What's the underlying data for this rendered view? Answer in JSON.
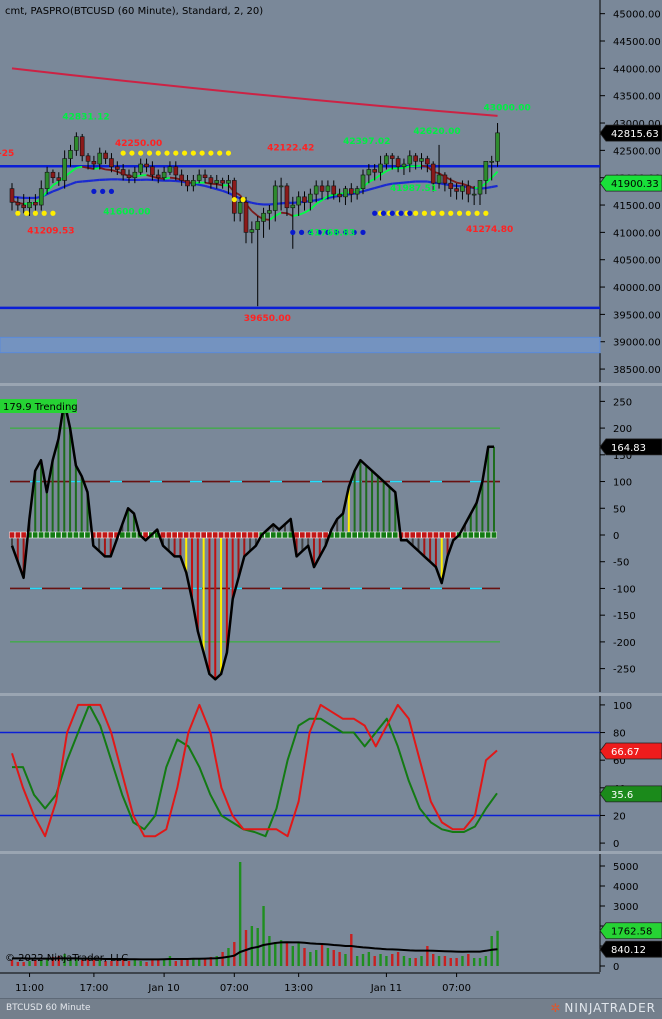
{
  "header": {
    "title": "cmt,  PASPRO(BTCUSD (60 Minute), Standard, 2, 20)",
    "copyright": "© 2022 NinjaTrader, LLC"
  },
  "status_bar": {
    "instrument": "BTCUSD 60 Minute",
    "brand": "NINJATRADER"
  },
  "colors": {
    "background": "#7a8899",
    "up_candle": "#2e8b2e",
    "down_candle": "#8b1a1a",
    "fast_ma": "#00ff44",
    "slow_ma": "#1a2ad0",
    "trend_line": "#cc2244",
    "support_line": "#0a1ed6",
    "cci_line": "#000000",
    "stoch_k": "#e01818",
    "stoch_d": "#137a13"
  },
  "chart_data": [
    {
      "type": "candlestick",
      "panel": "price",
      "price_axis_labels": [
        "45000.00",
        "44500.00",
        "44000.00",
        "43500.00",
        "43000.00",
        "42500.00",
        "42000.00",
        "41500.00",
        "41000.00",
        "40500.00",
        "40000.00",
        "39500.00",
        "39000.00",
        "38500.00"
      ],
      "price_tick_values": [
        45000,
        44500,
        44000,
        43500,
        43000,
        42500,
        42000,
        41500,
        41000,
        40500,
        40000,
        39500,
        39000,
        38500
      ],
      "ylim": [
        38300,
        45250
      ],
      "time_labels": [
        "11:00",
        "17:00",
        "Jan 10",
        "07:00",
        "13:00",
        "Jan 11",
        "07:00"
      ],
      "time_label_index": [
        3,
        14,
        26,
        38,
        49,
        64,
        76
      ],
      "bar_count": 84,
      "opens": [
        41800,
        41550,
        41500,
        41450,
        41550,
        41500,
        41800,
        42100,
        42000,
        41950,
        42350,
        42500,
        42750,
        42400,
        42300,
        42250,
        42450,
        42350,
        42200,
        42150,
        42050,
        42000,
        42100,
        42250,
        42200,
        42050,
        42000,
        42100,
        42200,
        42050,
        41950,
        41850,
        41950,
        42050,
        42000,
        41900,
        41950,
        41900,
        41950,
        41350,
        41550,
        41000,
        41050,
        41200,
        41350,
        41400,
        41850,
        41850,
        41450,
        41500,
        41650,
        41550,
        41700,
        41850,
        41750,
        41850,
        41700,
        41650,
        41800,
        41700,
        41800,
        42050,
        42150,
        42100,
        42250,
        42400,
        42350,
        42200,
        42250,
        42400,
        42300,
        42350,
        42250,
        41900,
        42050,
        41900,
        41800,
        41750,
        41850,
        41700,
        41700,
        41950,
        42300,
        42300
      ],
      "closes": [
        41550,
        41500,
        41450,
        41550,
        41500,
        41800,
        42100,
        42000,
        41950,
        42350,
        42500,
        42750,
        42400,
        42300,
        42250,
        42450,
        42350,
        42200,
        42150,
        42050,
        42000,
        42100,
        42250,
        42200,
        42050,
        42000,
        42100,
        42200,
        42050,
        41950,
        41850,
        41950,
        42050,
        42000,
        41900,
        41950,
        41900,
        41950,
        41350,
        41550,
        41000,
        41050,
        41200,
        41350,
        41400,
        41850,
        41850,
        41450,
        41500,
        41650,
        41550,
        41700,
        41850,
        41750,
        41850,
        41700,
        41650,
        41800,
        41700,
        41800,
        42050,
        42150,
        42100,
        42250,
        42400,
        42350,
        42200,
        42250,
        42400,
        42300,
        42350,
        42250,
        41900,
        42050,
        41900,
        41800,
        41750,
        41850,
        41700,
        41700,
        41950,
        42300,
        42300,
        42820
      ],
      "highs": [
        41900,
        41650,
        41700,
        41650,
        41700,
        41950,
        42200,
        42150,
        42100,
        42500,
        42600,
        42830,
        42800,
        42450,
        42400,
        42550,
        42500,
        42450,
        42300,
        42250,
        42150,
        42200,
        42350,
        42350,
        42300,
        42150,
        42200,
        42300,
        42300,
        42150,
        42050,
        42050,
        42150,
        42150,
        42050,
        42050,
        42000,
        42050,
        42000,
        41650,
        41650,
        41200,
        41300,
        41450,
        41500,
        41950,
        42000,
        41900,
        41650,
        41750,
        41750,
        41800,
        41950,
        41950,
        41950,
        41950,
        41800,
        41850,
        41900,
        41850,
        42150,
        42250,
        42250,
        42400,
        42450,
        42450,
        42400,
        42350,
        42500,
        42450,
        42450,
        42400,
        42300,
        42600,
        42100,
        42000,
        41900,
        41950,
        41950,
        41850,
        41850,
        42050,
        42400,
        43000
      ],
      "lows": [
        41400,
        41300,
        41350,
        41300,
        41400,
        41400,
        41700,
        41900,
        41850,
        41800,
        42200,
        42400,
        42300,
        42150,
        42150,
        42150,
        42250,
        42100,
        42050,
        41950,
        41900,
        41900,
        42050,
        42100,
        41950,
        41900,
        41950,
        42050,
        41950,
        41850,
        41750,
        41750,
        41900,
        41900,
        41800,
        41800,
        41800,
        41700,
        41200,
        41200,
        40800,
        40800,
        39650,
        40900,
        41050,
        41200,
        41400,
        41300,
        40700,
        41300,
        41400,
        41400,
        41550,
        41600,
        41600,
        41600,
        41550,
        41500,
        41550,
        41600,
        41700,
        41900,
        41950,
        41950,
        42150,
        42150,
        42100,
        42050,
        42100,
        42150,
        42150,
        42100,
        41750,
        41800,
        41750,
        41650,
        41600,
        41600,
        41550,
        41500,
        41500,
        41700,
        41950,
        42200
      ],
      "fast_ma": [
        41580,
        41540,
        41520,
        41530,
        41540,
        41620,
        41750,
        41860,
        41930,
        42020,
        42100,
        42180,
        42200,
        42180,
        42160,
        42180,
        42150,
        42140,
        42110,
        42070,
        42030,
        42020,
        42040,
        42050,
        42020,
        41990,
        41980,
        42000,
        41990,
        41960,
        41920,
        41900,
        41910,
        41910,
        41890,
        41880,
        41860,
        41860,
        41740,
        41680,
        41520,
        41390,
        41300,
        41240,
        41230,
        41300,
        41360,
        41350,
        41300,
        41320,
        41360,
        41420,
        41520,
        41590,
        41660,
        41690,
        41700,
        41730,
        41730,
        41750,
        41830,
        41920,
        41980,
        42050,
        42120,
        42170,
        42170,
        42180,
        42210,
        42210,
        42220,
        42200,
        42110,
        42080,
        42020,
        41960,
        41910,
        41890,
        41850,
        41810,
        41820,
        41900,
        42000,
        42110
      ],
      "slow_ma": [
        41650,
        41640,
        41630,
        41630,
        41630,
        41650,
        41700,
        41750,
        41790,
        41840,
        41880,
        41920,
        41930,
        41940,
        41950,
        41960,
        41965,
        41970,
        41970,
        41965,
        41960,
        41960,
        41960,
        41965,
        41960,
        41950,
        41945,
        41945,
        41940,
        41930,
        41910,
        41890,
        41870,
        41850,
        41820,
        41790,
        41760,
        41720,
        41670,
        41620,
        41570,
        41540,
        41520,
        41510,
        41510,
        41520,
        41530,
        41540,
        41540,
        41550,
        41560,
        41570,
        41590,
        41610,
        41630,
        41650,
        41670,
        41690,
        41700,
        41720,
        41750,
        41780,
        41810,
        41840,
        41870,
        41890,
        41900,
        41910,
        41920,
        41930,
        41930,
        41930,
        41910,
        41900,
        41880,
        41860,
        41850,
        41840,
        41830,
        41810,
        41800,
        41810,
        41830,
        41850
      ],
      "trend_line": {
        "start": 44000,
        "end": 43130
      },
      "horizontal_lines": [
        42210,
        39620
      ],
      "zone": [
        38800,
        39080
      ],
      "dots_yellow": [
        {
          "from": 1,
          "to": 7,
          "price": 41350
        },
        {
          "from": 19,
          "to": 37,
          "price": 42450
        },
        {
          "from": 38,
          "to": 40,
          "price": 41600
        },
        {
          "from": 63,
          "to": 81,
          "price": 41350
        }
      ],
      "dots_blue": [
        {
          "from": 14,
          "to": 18,
          "price": 41750
        },
        {
          "from": 48,
          "to": 61,
          "price": 41000
        },
        {
          "from": 62,
          "to": 69,
          "price": 41350
        }
      ],
      "annotations": [
        {
          "text": "42831.12",
          "index": 11,
          "price": 43060,
          "color": "#00ee44"
        },
        {
          "text": "42250.00",
          "index": 20,
          "price": 42580,
          "color": "#ff2222"
        },
        {
          "text": "42122.42",
          "index": 46,
          "price": 42500,
          "color": "#ff2222"
        },
        {
          "text": "42397.02",
          "index": 59,
          "price": 42620,
          "color": "#00ee44"
        },
        {
          "text": "42620.00",
          "index": 71,
          "price": 42800,
          "color": "#00ee44"
        },
        {
          "text": "43000.00",
          "index": 83,
          "price": 43230,
          "color": "#00ee44"
        },
        {
          "text": "41600.00",
          "index": 18,
          "price": 41330,
          "color": "#00ee44"
        },
        {
          "text": "41209.53",
          "index": 5,
          "price": 40980,
          "color": "#ff2222"
        },
        {
          "text": "41768.83",
          "index": 53,
          "price": 40940,
          "color": "#00ee44"
        },
        {
          "text": "41987.51",
          "index": 67,
          "price": 41760,
          "color": "#00ee44"
        },
        {
          "text": "41274.80",
          "index": 80,
          "price": 41010,
          "color": "#ff2222"
        },
        {
          "text": "39650.00",
          "index": 42,
          "price": 39380,
          "color": "#ff2222"
        },
        {
          "text": "-25",
          "index": 0,
          "price": 42400,
          "color": "#ff2222"
        }
      ],
      "current_price": "42815.63",
      "ma_price": "41900.33"
    },
    {
      "type": "line",
      "panel": "cci",
      "name": "179.9 Trending",
      "axis_labels": [
        "250",
        "200",
        "150",
        "100",
        "50",
        "0",
        "-50",
        "-100",
        "-150",
        "-200",
        "-250"
      ],
      "tick_values": [
        250,
        200,
        150,
        100,
        50,
        0,
        -50,
        -100,
        -150,
        -200,
        -250
      ],
      "ylim": [
        -290,
        275
      ],
      "levels": [
        200,
        100,
        0,
        -100,
        -200
      ],
      "values": [
        -20,
        -50,
        -80,
        30,
        120,
        140,
        80,
        140,
        180,
        250,
        200,
        130,
        110,
        80,
        -20,
        -30,
        -40,
        -40,
        -10,
        20,
        50,
        40,
        0,
        -10,
        0,
        10,
        -20,
        -30,
        -40,
        -40,
        -70,
        -120,
        -180,
        -220,
        -260,
        -270,
        -260,
        -220,
        -120,
        -80,
        -40,
        -30,
        -20,
        0,
        10,
        20,
        10,
        20,
        30,
        -40,
        -30,
        -20,
        -60,
        -40,
        -20,
        10,
        30,
        40,
        90,
        120,
        140,
        130,
        120,
        110,
        100,
        90,
        80,
        -10,
        -10,
        -20,
        -30,
        -40,
        -50,
        -60,
        -90,
        -40,
        -10,
        0,
        20,
        40,
        60,
        100,
        165,
        165
      ],
      "last_value": "164.83"
    },
    {
      "type": "line",
      "panel": "stochastic",
      "axis_labels": [
        "100",
        "80",
        "60",
        "40",
        "20",
        "0"
      ],
      "tick_values": [
        100,
        80,
        60,
        40,
        20,
        0
      ],
      "ylim": [
        -5,
        105
      ],
      "levels": [
        80,
        20
      ],
      "k_values": [
        65,
        40,
        20,
        5,
        30,
        80,
        100,
        100,
        100,
        80,
        50,
        20,
        5,
        5,
        10,
        40,
        80,
        100,
        80,
        40,
        20,
        10,
        10,
        10,
        10,
        5,
        30,
        80,
        100,
        95,
        90,
        90,
        85,
        70,
        85,
        100,
        90,
        60,
        30,
        15,
        10,
        10,
        20,
        60,
        67
      ],
      "d_values": [
        55,
        55,
        35,
        25,
        35,
        60,
        80,
        100,
        85,
        60,
        35,
        15,
        10,
        20,
        55,
        75,
        70,
        55,
        35,
        20,
        15,
        10,
        8,
        5,
        25,
        60,
        85,
        90,
        90,
        85,
        80,
        80,
        70,
        80,
        90,
        70,
        45,
        25,
        15,
        10,
        8,
        8,
        12,
        25,
        36
      ],
      "k_last": "66.67",
      "d_last": "35.6"
    },
    {
      "type": "bar",
      "panel": "volume",
      "axis_labels": [
        "5000",
        "4000",
        "3000",
        "2000",
        "1000",
        "0"
      ],
      "tick_values": [
        5000,
        4000,
        3000,
        2000,
        1000,
        0
      ],
      "ylim": [
        -200,
        5500
      ],
      "values": [
        300,
        200,
        200,
        250,
        300,
        300,
        400,
        450,
        500,
        600,
        400,
        350,
        300,
        350,
        300,
        300,
        250,
        250,
        300,
        350,
        250,
        300,
        250,
        200,
        300,
        300,
        350,
        500,
        250,
        300,
        300,
        400,
        350,
        400,
        450,
        500,
        700,
        900,
        1200,
        5200,
        1800,
        2000,
        1900,
        3000,
        1500,
        1200,
        1300,
        1200,
        1000,
        1200,
        900,
        700,
        800,
        1100,
        900,
        800,
        700,
        600,
        1600,
        500,
        600,
        700,
        500,
        600,
        500,
        600,
        700,
        500,
        400,
        400,
        500,
        1000,
        600,
        500,
        500,
        400,
        400,
        500,
        600,
        400,
        400,
        500,
        1500,
        1760
      ],
      "avg_values": [
        380,
        380,
        380,
        370,
        370,
        370,
        370,
        370,
        380,
        380,
        380,
        380,
        370,
        370,
        360,
        360,
        350,
        350,
        350,
        350,
        340,
        340,
        330,
        330,
        330,
        330,
        340,
        350,
        350,
        350,
        350,
        360,
        360,
        370,
        380,
        390,
        420,
        460,
        520,
        700,
        800,
        900,
        950,
        1050,
        1100,
        1150,
        1180,
        1190,
        1180,
        1180,
        1160,
        1130,
        1110,
        1100,
        1080,
        1050,
        1030,
        1000,
        1000,
        960,
        930,
        910,
        880,
        860,
        840,
        830,
        820,
        800,
        780,
        770,
        770,
        770,
        760,
        750,
        740,
        730,
        720,
        710,
        720,
        720,
        720,
        760,
        810,
        840
      ],
      "last_value": "1762.58",
      "avg_last": "840.12"
    }
  ]
}
